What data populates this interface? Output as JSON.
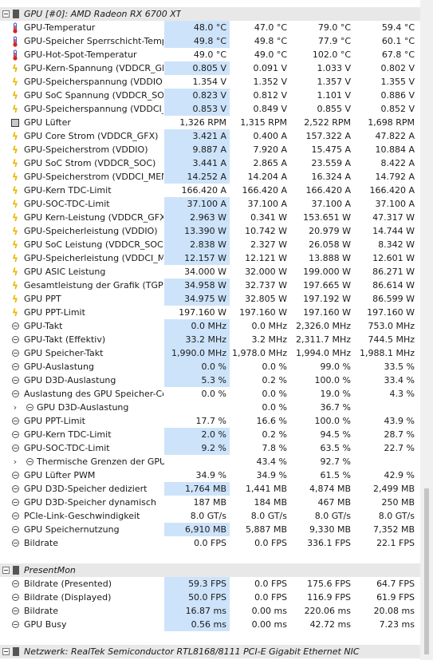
{
  "groups": [
    {
      "title": "GPU [#0]: AMD Radeon RX 6700 XT",
      "rows": [
        {
          "icon": "thermometer-icon",
          "label": "GPU-Temperatur",
          "values": [
            "48.0 °C",
            "47.0 °C",
            "79.0 °C",
            "59.4 °C"
          ],
          "hl": true
        },
        {
          "icon": "thermometer-icon",
          "label": "GPU-Speicher Sperrschicht-Temp...",
          "values": [
            "49.8 °C",
            "49.8 °C",
            "77.9 °C",
            "60.1 °C"
          ],
          "hl": true
        },
        {
          "icon": "thermometer-icon",
          "label": "GPU-Hot-Spot-Temperatur",
          "values": [
            "49.0 °C",
            "49.0 °C",
            "102.0 °C",
            "67.8 °C"
          ],
          "hl": false
        },
        {
          "icon": "bolt-icon",
          "label": "GPU-Kern-Spannung (VDDCR_GFX)",
          "values": [
            "0.805 V",
            "0.091 V",
            "1.033 V",
            "0.802 V"
          ],
          "hl": true
        },
        {
          "icon": "bolt-icon",
          "label": "GPU-Speicherspannung (VDDIO)",
          "values": [
            "1.354 V",
            "1.352 V",
            "1.357 V",
            "1.355 V"
          ],
          "hl": false
        },
        {
          "icon": "bolt-icon",
          "label": "GPU SoC Spannung (VDDCR_SOC)",
          "values": [
            "0.823 V",
            "0.812 V",
            "1.101 V",
            "0.886 V"
          ],
          "hl": true
        },
        {
          "icon": "bolt-icon",
          "label": "GPU-Speicherspannung (VDDCI_...",
          "values": [
            "0.853 V",
            "0.849 V",
            "0.855 V",
            "0.852 V"
          ],
          "hl": true
        },
        {
          "icon": "fan-icon",
          "label": "GPU Lüfter",
          "values": [
            "1,326 RPM",
            "1,315 RPM",
            "2,522 RPM",
            "1,698 RPM"
          ],
          "hl": false
        },
        {
          "icon": "bolt-icon",
          "label": "GPU Core Strom (VDDCR_GFX)",
          "values": [
            "3.421 A",
            "0.400 A",
            "157.322 A",
            "47.822 A"
          ],
          "hl": true
        },
        {
          "icon": "bolt-icon",
          "label": "GPU-Speicherstrom (VDDIO)",
          "values": [
            "9.887 A",
            "7.920 A",
            "15.475 A",
            "10.884 A"
          ],
          "hl": true
        },
        {
          "icon": "bolt-icon",
          "label": "GPU SoC Strom (VDDCR_SOC)",
          "values": [
            "3.441 A",
            "2.865 A",
            "23.559 A",
            "8.422 A"
          ],
          "hl": true
        },
        {
          "icon": "bolt-icon",
          "label": "GPU-Speicherstrom (VDDCI_MEM)",
          "values": [
            "14.252 A",
            "14.204 A",
            "16.324 A",
            "14.792 A"
          ],
          "hl": true
        },
        {
          "icon": "bolt-icon",
          "label": "GPU-Kern TDC-Limit",
          "values": [
            "166.420 A",
            "166.420 A",
            "166.420 A",
            "166.420 A"
          ],
          "hl": false
        },
        {
          "icon": "bolt-icon",
          "label": "GPU-SOC-TDC-Limit",
          "values": [
            "37.100 A",
            "37.100 A",
            "37.100 A",
            "37.100 A"
          ],
          "hl": true
        },
        {
          "icon": "bolt-icon",
          "label": "GPU Kern-Leistung (VDDCR_GFX)",
          "values": [
            "2.963 W",
            "0.341 W",
            "153.651 W",
            "47.317 W"
          ],
          "hl": true
        },
        {
          "icon": "bolt-icon",
          "label": "GPU-Speicherleistung (VDDIO)",
          "values": [
            "13.390 W",
            "10.742 W",
            "20.979 W",
            "14.744 W"
          ],
          "hl": true
        },
        {
          "icon": "bolt-icon",
          "label": "GPU SoC Leistung (VDDCR_SOC)",
          "values": [
            "2.838 W",
            "2.327 W",
            "26.058 W",
            "8.342 W"
          ],
          "hl": true
        },
        {
          "icon": "bolt-icon",
          "label": "GPU-Speicherleistung (VDDCI_MEM)",
          "values": [
            "12.157 W",
            "12.121 W",
            "13.888 W",
            "12.601 W"
          ],
          "hl": true
        },
        {
          "icon": "bolt-icon",
          "label": "GPU ASIC Leistung",
          "values": [
            "34.000 W",
            "32.000 W",
            "199.000 W",
            "86.271 W"
          ],
          "hl": false
        },
        {
          "icon": "bolt-icon",
          "label": "Gesamtleistung der Grafik (TGP)",
          "values": [
            "34.958 W",
            "32.737 W",
            "197.665 W",
            "86.614 W"
          ],
          "hl": true
        },
        {
          "icon": "bolt-icon",
          "label": "GPU PPT",
          "values": [
            "34.975 W",
            "32.805 W",
            "197.192 W",
            "86.599 W"
          ],
          "hl": true
        },
        {
          "icon": "bolt-icon",
          "label": "GPU PPT-Limit",
          "values": [
            "197.160 W",
            "197.160 W",
            "197.160 W",
            "197.160 W"
          ],
          "hl": false
        },
        {
          "icon": "clock-icon",
          "label": "GPU-Takt",
          "values": [
            "0.0 MHz",
            "0.0 MHz",
            "2,326.0 MHz",
            "753.0 MHz"
          ],
          "hl": true
        },
        {
          "icon": "clock-icon",
          "label": "GPU-Takt (Effektiv)",
          "values": [
            "33.2 MHz",
            "3.2 MHz",
            "2,311.7 MHz",
            "744.5 MHz"
          ],
          "hl": true
        },
        {
          "icon": "clock-icon",
          "label": "GPU Speicher-Takt",
          "values": [
            "1,990.0 MHz",
            "1,978.0 MHz",
            "1,994.0 MHz",
            "1,988.1 MHz"
          ],
          "hl": true
        },
        {
          "icon": "clock-icon",
          "label": "GPU-Auslastung",
          "values": [
            "0.0 %",
            "0.0 %",
            "99.0 %",
            "33.5 %"
          ],
          "hl": true
        },
        {
          "icon": "clock-icon",
          "label": "GPU D3D-Auslastung",
          "values": [
            "5.3 %",
            "0.2 %",
            "100.0 %",
            "33.4 %"
          ],
          "hl": true
        },
        {
          "icon": "clock-icon",
          "label": "Auslastung des GPU Speicher-Co...",
          "values": [
            "0.0 %",
            "0.0 %",
            "19.0 %",
            "4.3 %"
          ],
          "hl": false
        },
        {
          "icon": "clock-icon",
          "label": "GPU D3D-Auslastung",
          "values": [
            "",
            "0.0 %",
            "36.7 %",
            ""
          ],
          "hl": false,
          "collapsed": true
        },
        {
          "icon": "clock-icon",
          "label": "GPU PPT-Limit",
          "values": [
            "17.7 %",
            "16.6 %",
            "100.0 %",
            "43.9 %"
          ],
          "hl": false
        },
        {
          "icon": "clock-icon",
          "label": "GPU-Kern TDC-Limit",
          "values": [
            "2.0 %",
            "0.2 %",
            "94.5 %",
            "28.7 %"
          ],
          "hl": true
        },
        {
          "icon": "clock-icon",
          "label": "GPU-SOC-TDC-Limit",
          "values": [
            "9.2 %",
            "7.8 %",
            "63.5 %",
            "22.7 %"
          ],
          "hl": true
        },
        {
          "icon": "clock-icon",
          "label": "Thermische Grenzen der GPU",
          "values": [
            "",
            "43.4 %",
            "92.7 %",
            ""
          ],
          "hl": false,
          "collapsed": true
        },
        {
          "icon": "clock-icon",
          "label": "GPU Lüfter PWM",
          "values": [
            "34.9 %",
            "34.9 %",
            "61.5 %",
            "42.9 %"
          ],
          "hl": false
        },
        {
          "icon": "clock-icon",
          "label": "GPU D3D-Speicher dediziert",
          "values": [
            "1,764 MB",
            "1,441 MB",
            "4,874 MB",
            "2,499 MB"
          ],
          "hl": true
        },
        {
          "icon": "clock-icon",
          "label": "GPU D3D-Speicher dynamisch",
          "values": [
            "187 MB",
            "184 MB",
            "467 MB",
            "250 MB"
          ],
          "hl": false
        },
        {
          "icon": "clock-icon",
          "label": "PCIe-Link-Geschwindigkeit",
          "values": [
            "8.0 GT/s",
            "8.0 GT/s",
            "8.0 GT/s",
            "8.0 GT/s"
          ],
          "hl": false
        },
        {
          "icon": "clock-icon",
          "label": "GPU Speichernutzung",
          "values": [
            "6,910 MB",
            "5,887 MB",
            "9,330 MB",
            "7,352 MB"
          ],
          "hl": true
        },
        {
          "icon": "clock-icon",
          "label": "Bildrate",
          "values": [
            "0.0 FPS",
            "0.0 FPS",
            "336.1 FPS",
            "22.1 FPS"
          ],
          "hl": false
        }
      ]
    },
    {
      "title": "PresentMon",
      "rows": [
        {
          "icon": "clock-icon",
          "label": "Bildrate (Presented)",
          "values": [
            "59.3 FPS",
            "0.0 FPS",
            "175.6 FPS",
            "64.7 FPS"
          ],
          "hl": true
        },
        {
          "icon": "clock-icon",
          "label": "Bildrate (Displayed)",
          "values": [
            "50.0 FPS",
            "0.0 FPS",
            "116.9 FPS",
            "61.9 FPS"
          ],
          "hl": true
        },
        {
          "icon": "clock-icon",
          "label": "Bildrate",
          "values": [
            "16.87 ms",
            "0.00 ms",
            "220.06 ms",
            "20.08 ms"
          ],
          "hl": true
        },
        {
          "icon": "clock-icon",
          "label": "GPU Busy",
          "values": [
            "0.56 ms",
            "0.00 ms",
            "42.72 ms",
            "7.23 ms"
          ],
          "hl": true
        }
      ]
    },
    {
      "title": "Netzwerk: RealTek Semiconductor RTL8168/8111 PCI-E Gigabit Ethernet NIC",
      "rows": []
    }
  ]
}
